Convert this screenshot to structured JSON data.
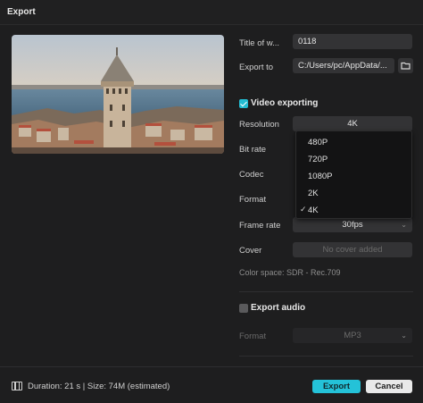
{
  "window": {
    "title": "Export"
  },
  "export_settings": {
    "title_label": "Title of w...",
    "title_value": "0118",
    "export_to_label": "Export to",
    "export_to_value": "C:/Users/pc/AppData/...",
    "folder_icon": "folder-icon"
  },
  "video": {
    "section_label": "Video exporting",
    "enabled": true,
    "resolution_label": "Resolution",
    "resolution_value": "4K",
    "bitrate_label": "Bit rate",
    "codec_label": "Codec",
    "format_label": "Format",
    "framerate_label": "Frame rate",
    "framerate_value": "30fps",
    "cover_label": "Cover",
    "cover_value": "No cover added",
    "color_space": "Color space: SDR - Rec.709"
  },
  "resolution_dropdown": {
    "options": [
      "480P",
      "720P",
      "1080P",
      "2K",
      "4K"
    ],
    "selected": "4K",
    "check_icon": "✓"
  },
  "audio": {
    "section_label": "Export audio",
    "enabled": false,
    "format_label": "Format",
    "format_value": "MP3"
  },
  "footer": {
    "duration_text": "Duration: 21 s | Size: 74M (estimated)",
    "export_label": "Export",
    "cancel_label": "Cancel"
  },
  "colors": {
    "accent": "#24c2d8",
    "background": "#1e1e1f"
  }
}
